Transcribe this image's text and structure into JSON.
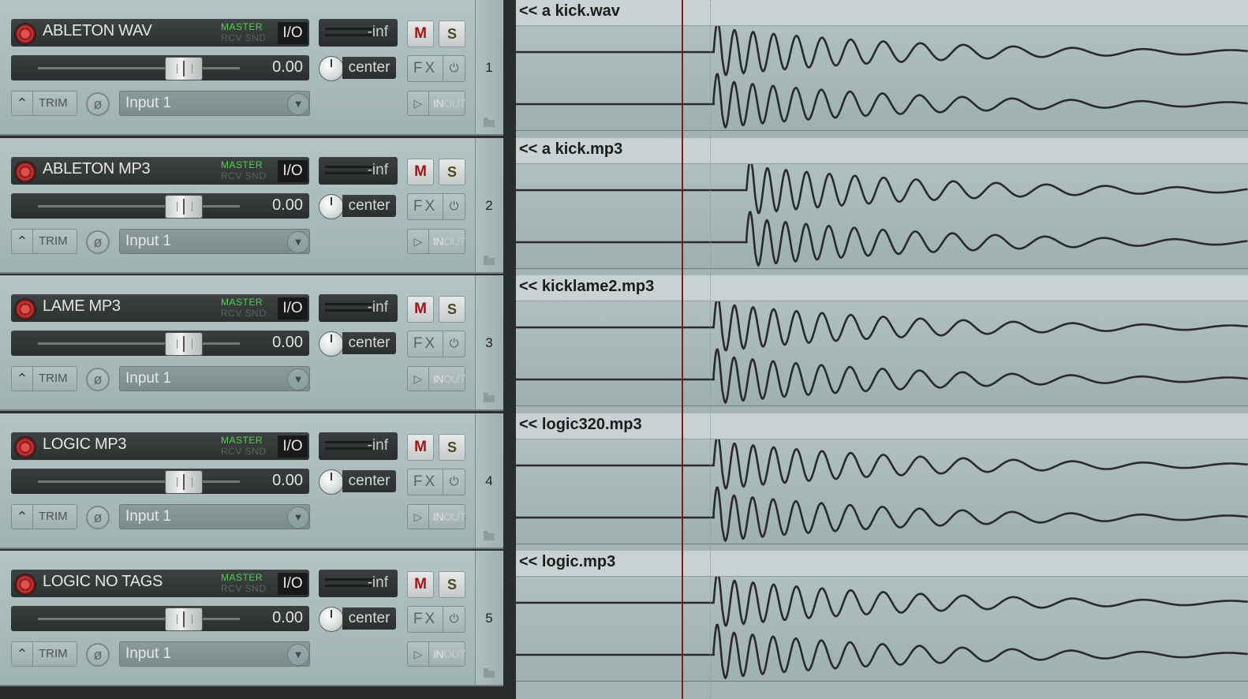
{
  "tracks": [
    {
      "number": "1",
      "name": "ABLETON WAV",
      "routing_master": "MASTER",
      "routing_rcv": "RCV SND",
      "io_label": "I/O",
      "meter": "-inf",
      "volume": "0.00",
      "pan": "center",
      "mute": "M",
      "solo": "S",
      "fx": "FX",
      "trim": "TRIM",
      "input": "Input 1",
      "monitor_in": "IN",
      "monitor_out": "OUT",
      "item_name": "<< a kick.wav",
      "onset": 0.27
    },
    {
      "number": "2",
      "name": "ABLETON MP3",
      "routing_master": "MASTER",
      "routing_rcv": "RCV SND",
      "io_label": "I/O",
      "meter": "-inf",
      "volume": "0.00",
      "pan": "center",
      "mute": "M",
      "solo": "S",
      "fx": "FX",
      "trim": "TRIM",
      "input": "Input 1",
      "monitor_in": "IN",
      "monitor_out": "OUT",
      "item_name": "<< a kick.mp3",
      "onset": 0.315
    },
    {
      "number": "3",
      "name": "LAME MP3",
      "routing_master": "MASTER",
      "routing_rcv": "RCV SND",
      "io_label": "I/O",
      "meter": "-inf",
      "volume": "0.00",
      "pan": "center",
      "mute": "M",
      "solo": "S",
      "fx": "FX",
      "trim": "TRIM",
      "input": "Input 1",
      "monitor_in": "IN",
      "monitor_out": "OUT",
      "item_name": "<< kicklame2.mp3",
      "onset": 0.27
    },
    {
      "number": "4",
      "name": "LOGIC MP3",
      "routing_master": "MASTER",
      "routing_rcv": "RCV SND",
      "io_label": "I/O",
      "meter": "-inf",
      "volume": "0.00",
      "pan": "center",
      "mute": "M",
      "solo": "S",
      "fx": "FX",
      "trim": "TRIM",
      "input": "Input 1",
      "monitor_in": "IN",
      "monitor_out": "OUT",
      "item_name": "<< logic320.mp3",
      "onset": 0.27
    },
    {
      "number": "5",
      "name": "LOGIC NO TAGS",
      "routing_master": "MASTER",
      "routing_rcv": "RCV SND",
      "io_label": "I/O",
      "meter": "-inf",
      "volume": "0.00",
      "pan": "center",
      "mute": "M",
      "solo": "S",
      "fx": "FX",
      "trim": "TRIM",
      "input": "Input 1",
      "monitor_in": "IN",
      "monitor_out": "OUT",
      "item_name": "<< logic.mp3",
      "onset": 0.27
    }
  ],
  "icons": {
    "record_arm": "record-arm-icon",
    "envelope": "envelope-icon",
    "phase": "phase-invert-icon",
    "dropdown": "chevron-down-icon",
    "fx_bypass": "power-icon",
    "monitor": "play-icon",
    "folder": "folder-icon"
  },
  "colors": {
    "record_arm": "#c23a3a",
    "routing_master": "#4ed34e",
    "mute_text": "#a21414",
    "edit_cursor": "#7a1e1e",
    "waveform": "#2a2a2a"
  }
}
